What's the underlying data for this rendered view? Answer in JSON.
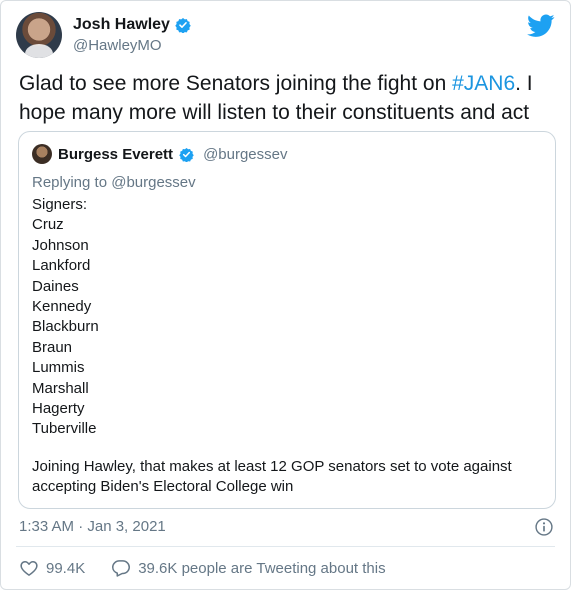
{
  "tweet": {
    "author_name": "Josh Hawley",
    "author_handle": "@HawleyMO",
    "text_before": "Glad to see more Senators joining the fight on ",
    "hashtag": "#JAN6",
    "text_after": ". I hope many more will listen to their constituents and act",
    "timestamp": "1:33 AM · Jan 3, 2021",
    "likes": "99.4K",
    "tweeting_about": "39.6K people are Tweeting about this"
  },
  "quote": {
    "author_name": "Burgess Everett",
    "author_handle": "@burgessev",
    "replying_to": "Replying to @burgessev",
    "lines": [
      "Signers:",
      "Cruz",
      "Johnson",
      "Lankford",
      "Daines",
      "Kennedy",
      "Blackburn",
      "Braun",
      "Lummis",
      "Marshall",
      "Hagerty",
      "Tuberville"
    ],
    "footer": "Joining Hawley, that makes at least 12 GOP senators set to vote against accepting Biden's Electoral College win"
  },
  "icons": {
    "verified": "verified-badge-icon",
    "twitter": "twitter-bird-icon",
    "info": "info-icon",
    "like": "heart-icon",
    "comment": "speech-bubble-icon"
  },
  "colors": {
    "accent": "#1da1f2",
    "hashtag": "#1b95e0",
    "secondary_text": "#657786"
  }
}
